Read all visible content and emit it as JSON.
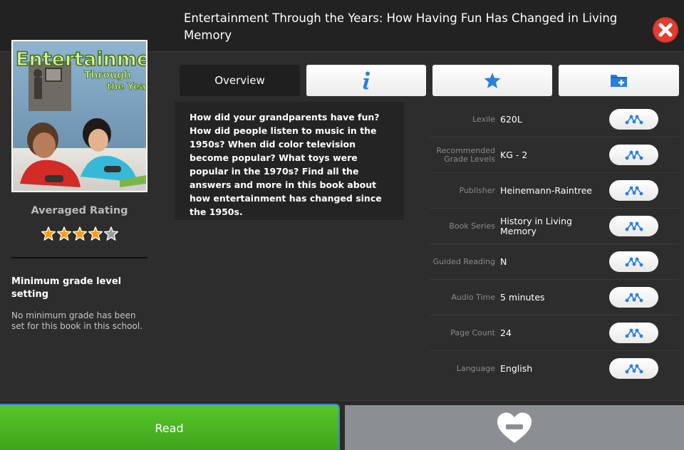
{
  "header": {
    "title": "Entertainment Through the Years: How Having Fun Has Changed in Living Memory"
  },
  "cover": {
    "title_line1": "Entertainment",
    "title_line2": "Through",
    "title_line3": "the Years"
  },
  "rating": {
    "label": "Averaged Rating",
    "value": 4,
    "max": 5,
    "filled_color": "#f39c1f",
    "empty_color": "#9a9a9a"
  },
  "min_grade": {
    "title": "Minimum grade level setting",
    "description": "No minimum grade has been set for this book in this school."
  },
  "tabs": [
    {
      "id": "overview",
      "label": "Overview",
      "active": true
    },
    {
      "id": "info",
      "icon": "info-icon"
    },
    {
      "id": "favorites",
      "icon": "star-icon"
    },
    {
      "id": "add-to-folder",
      "icon": "folder-add-icon"
    }
  ],
  "description": "How did your grandparents have fun? How did people listen to music in the 1950s? When did color television become popular? What toys were popular in the 1970s?  Find all the answers and more in this book about how entertainment has changed since the 1950s.",
  "details": [
    {
      "label": "Lexile",
      "value": "620L"
    },
    {
      "label": "Recommended Grade Levels",
      "value": "KG - 2"
    },
    {
      "label": "Publisher",
      "value": "Heinemann-Raintree"
    },
    {
      "label": "Book Series",
      "value": "History in Living Memory"
    },
    {
      "label": "Guided Reading",
      "value": "N"
    },
    {
      "label": "Audio Time",
      "value": "5 minutes"
    },
    {
      "label": "Page Count",
      "value": "24"
    },
    {
      "label": "Language",
      "value": "English"
    }
  ],
  "actions": {
    "read_label": "Read",
    "read_color": "#4cb723",
    "favorite_icon": "heart-minus-icon"
  },
  "colors": {
    "accent_blue": "#3d84d6",
    "close_red": "#e43d2f"
  }
}
